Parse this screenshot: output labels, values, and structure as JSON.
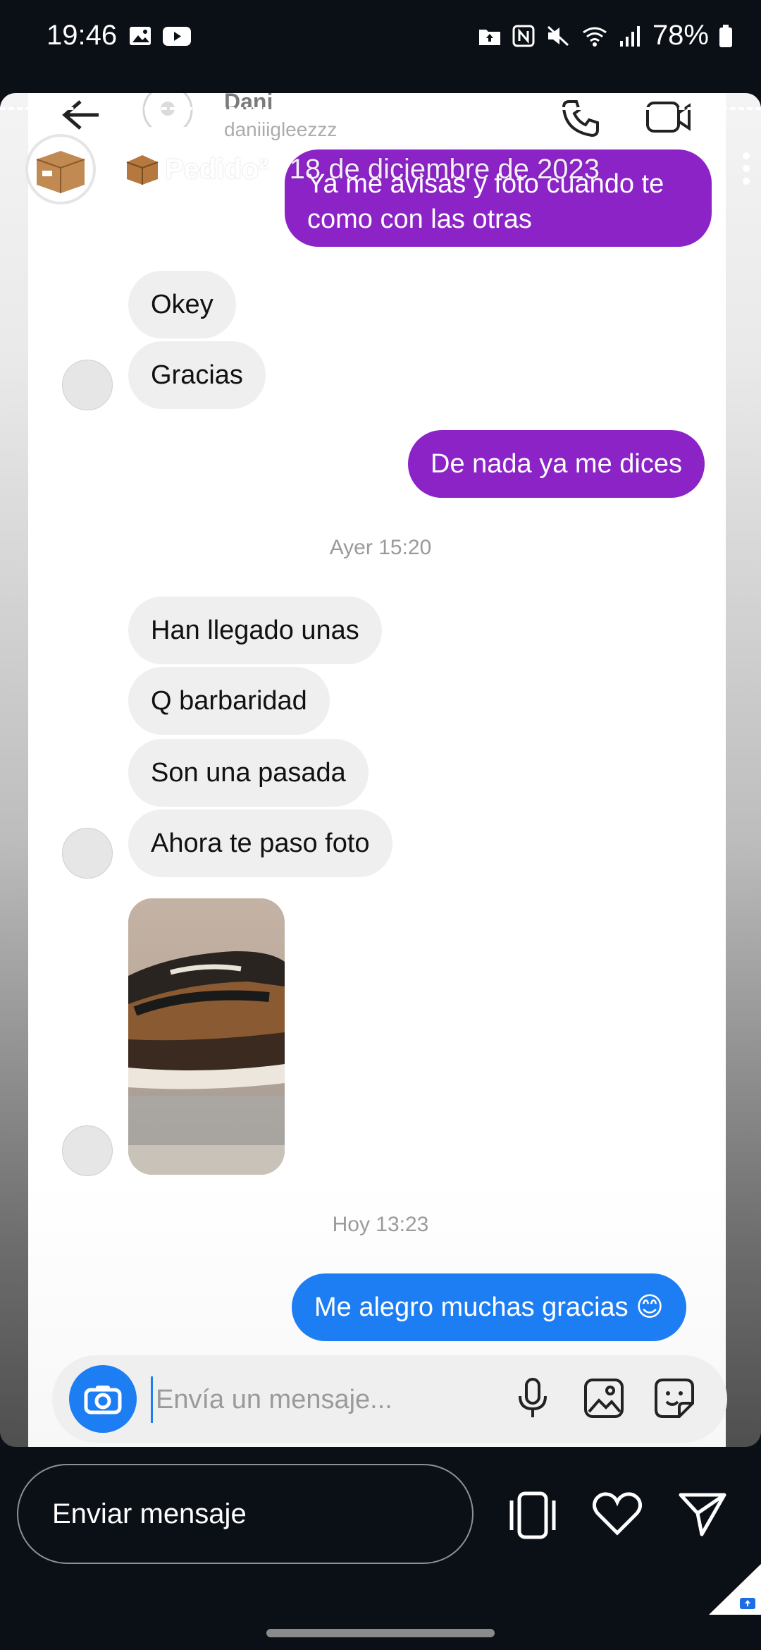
{
  "status_bar": {
    "time": "19:46",
    "battery": "78%"
  },
  "chat_header": {
    "peer_name": "Dani",
    "peer_username": "daniiigleezzz"
  },
  "story": {
    "owner_name": "Pedido²",
    "date": "18 de diciembre de 2023"
  },
  "messages": {
    "m1": "Ya me avisas y foto cuando te como con las otras",
    "m2": "Okey",
    "m3": "Gracias",
    "m4": "De nada ya me dices",
    "ts1": "Ayer 15:20",
    "m5": "Han llegado unas",
    "m6": "Q barbaridad",
    "m7": "Son una pasada",
    "m8": "Ahora te paso foto",
    "ts2": "Hoy 13:23",
    "m9": "Me alegro muchas gracias 😊"
  },
  "composer": {
    "placeholder": "Envía un mensaje..."
  },
  "bottom_bar": {
    "reply_label": "Enviar mensaje"
  },
  "colors": {
    "purple": "#8b23c6",
    "blue": "#1d7ef3",
    "incoming": "#efefef",
    "background": "#0b0f16"
  },
  "icons": [
    "image-icon",
    "youtube-icon",
    "upload-icon",
    "nfc-icon",
    "mute-icon",
    "wifi-icon",
    "signal-icon",
    "battery-icon",
    "back-icon",
    "phone-icon",
    "video-icon",
    "more-icon",
    "camera-icon",
    "mic-icon",
    "gallery-icon",
    "sticker-icon",
    "switch-icon",
    "heart-icon",
    "send-icon"
  ]
}
